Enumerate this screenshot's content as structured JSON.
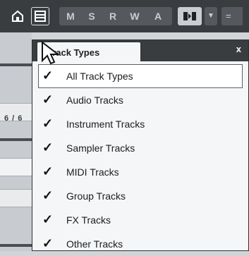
{
  "toolbar": {
    "buttons": [
      "M",
      "S",
      "R",
      "W",
      "A"
    ],
    "dropdown_glyph": "▼",
    "eq_glyph": "="
  },
  "track_list": {
    "count": "6 / 6"
  },
  "popup": {
    "title": "Track Types",
    "close": "x",
    "items": [
      {
        "label": "All Track Types",
        "checked": true,
        "selected": true
      },
      {
        "label": "Audio Tracks",
        "checked": true
      },
      {
        "label": "Instrument Tracks",
        "checked": true
      },
      {
        "label": "Sampler Tracks",
        "checked": true
      },
      {
        "label": "MIDI Tracks",
        "checked": true
      },
      {
        "label": "Group Tracks",
        "checked": true
      },
      {
        "label": "FX Tracks",
        "checked": true
      },
      {
        "label": "Other Tracks",
        "checked": true
      }
    ]
  },
  "icons": [
    "home-icon",
    "list-icon",
    "arrow-cursor-icon",
    "checkmark-icon"
  ]
}
